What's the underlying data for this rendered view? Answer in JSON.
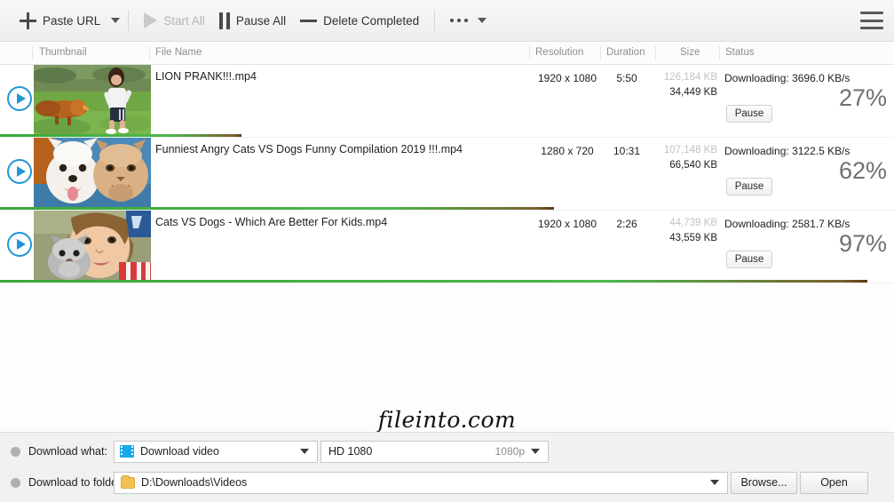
{
  "toolbar": {
    "paste_url": "Paste URL",
    "start_all": "Start All",
    "pause_all": "Pause All",
    "delete_completed": "Delete Completed",
    "menu_icon": "hamburger-icon",
    "more_icon": "ellipsis-icon"
  },
  "columns": {
    "thumbnail": "Thumbnail",
    "file_name": "File Name",
    "resolution": "Resolution",
    "duration": "Duration",
    "size": "Size",
    "status": "Status"
  },
  "downloads": [
    {
      "file_name": "LION PRANK!!!.mp4",
      "resolution": "1920 x 1080",
      "duration": "5:50",
      "size_total": "126,184 KB",
      "size_done": "34,449 KB",
      "status": "Downloading: 3696.0 KB/s",
      "percent_label": "27%",
      "percent": 27,
      "pause_label": "Pause",
      "play_icon": "play-icon"
    },
    {
      "file_name": "Funniest Angry Cats VS Dogs Funny Compilation 2019 !!!.mp4",
      "resolution": "1280 x 720",
      "duration": "10:31",
      "size_total": "107,148 KB",
      "size_done": "66,540 KB",
      "status": "Downloading: 3122.5 KB/s",
      "percent_label": "62%",
      "percent": 62,
      "pause_label": "Pause",
      "play_icon": "play-icon"
    },
    {
      "file_name": "Cats VS Dogs - Which Are Better For Kids.mp4",
      "resolution": "1920 x 1080",
      "duration": "2:26",
      "size_total": "44,739 KB",
      "size_done": "43,559 KB",
      "status": "Downloading: 2581.7 KB/s",
      "percent_label": "97%",
      "percent": 97,
      "pause_label": "Pause",
      "play_icon": "play-icon"
    }
  ],
  "watermark": "fileinto.com",
  "bottom": {
    "download_what_label": "Download what:",
    "download_what_value": "Download video",
    "quality_value": "HD 1080",
    "quality_suffix": "1080p",
    "download_folder_label": "Download to folder:",
    "download_folder_value": "D:\\Downloads\\Videos",
    "browse_label": "Browse...",
    "open_label": "Open"
  },
  "colors": {
    "accent": "#2196d6",
    "progress": "#4cb84c",
    "film_icon": "#17a8e8",
    "folder_icon": "#f3c251"
  }
}
